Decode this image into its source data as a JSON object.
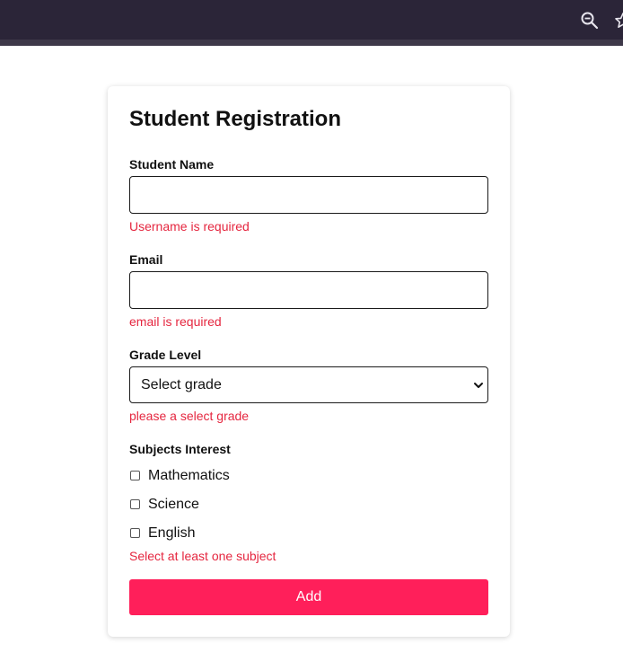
{
  "browser": {
    "zoom_icon": "zoom-out-icon",
    "bookmark_icon": "star-icon"
  },
  "form": {
    "title": "Student Registration",
    "student_name": {
      "label": "Student Name",
      "value": "",
      "error": "Username is required"
    },
    "email": {
      "label": "Email",
      "value": "",
      "error": "email is required"
    },
    "grade_level": {
      "label": "Grade Level",
      "selected": "Select grade",
      "error": "please a select grade"
    },
    "subjects": {
      "label": "Subjects Interest",
      "options": [
        {
          "label": "Mathematics",
          "checked": false
        },
        {
          "label": "Science",
          "checked": false
        },
        {
          "label": "English",
          "checked": false
        }
      ],
      "error": "Select at least one subject"
    },
    "submit_label": "Add"
  },
  "colors": {
    "error": "#e5263f",
    "button": "#ff1f5a",
    "browser_bar": "#2b2538"
  }
}
